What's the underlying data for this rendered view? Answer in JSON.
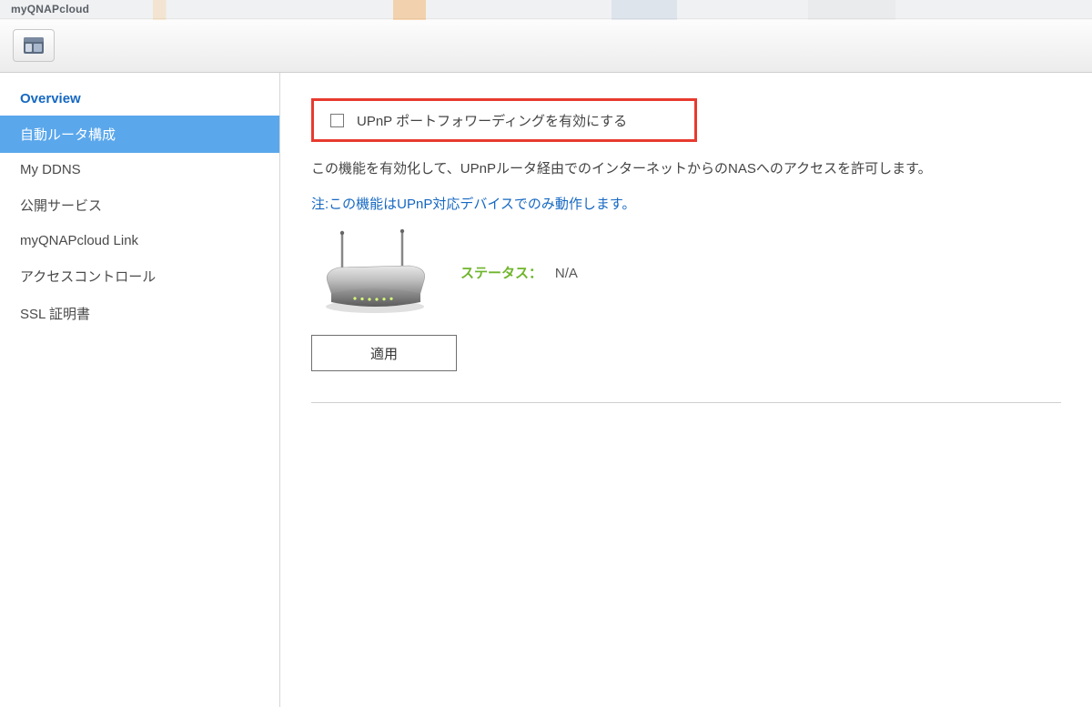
{
  "app": {
    "title": "myQNAPcloud"
  },
  "sidebar": {
    "items": [
      {
        "label": "Overview",
        "key": "overview"
      },
      {
        "label": "自動ルータ構成",
        "key": "auto-router-config",
        "active": true
      },
      {
        "label": "My DDNS",
        "key": "my-ddns"
      },
      {
        "label": "公開サービス",
        "key": "published-services"
      },
      {
        "label": "myQNAPcloud Link",
        "key": "myqnapcloud-link"
      },
      {
        "label": "アクセスコントロール",
        "key": "access-control"
      },
      {
        "label": "SSL 証明書",
        "key": "ssl-cert"
      }
    ]
  },
  "main": {
    "upnp_checkbox_label": "UPnP ポートフォワーディングを有効にする",
    "description": "この機能を有効化して、UPnPルータ経由でのインターネットからのNASへのアクセスを許可します。",
    "note_prefix": "注:",
    "note_text": "この機能はUPnP対応デバイスでのみ動作します。",
    "status_label": "ステータス：",
    "status_value": "N/A",
    "apply_button": "適用"
  }
}
